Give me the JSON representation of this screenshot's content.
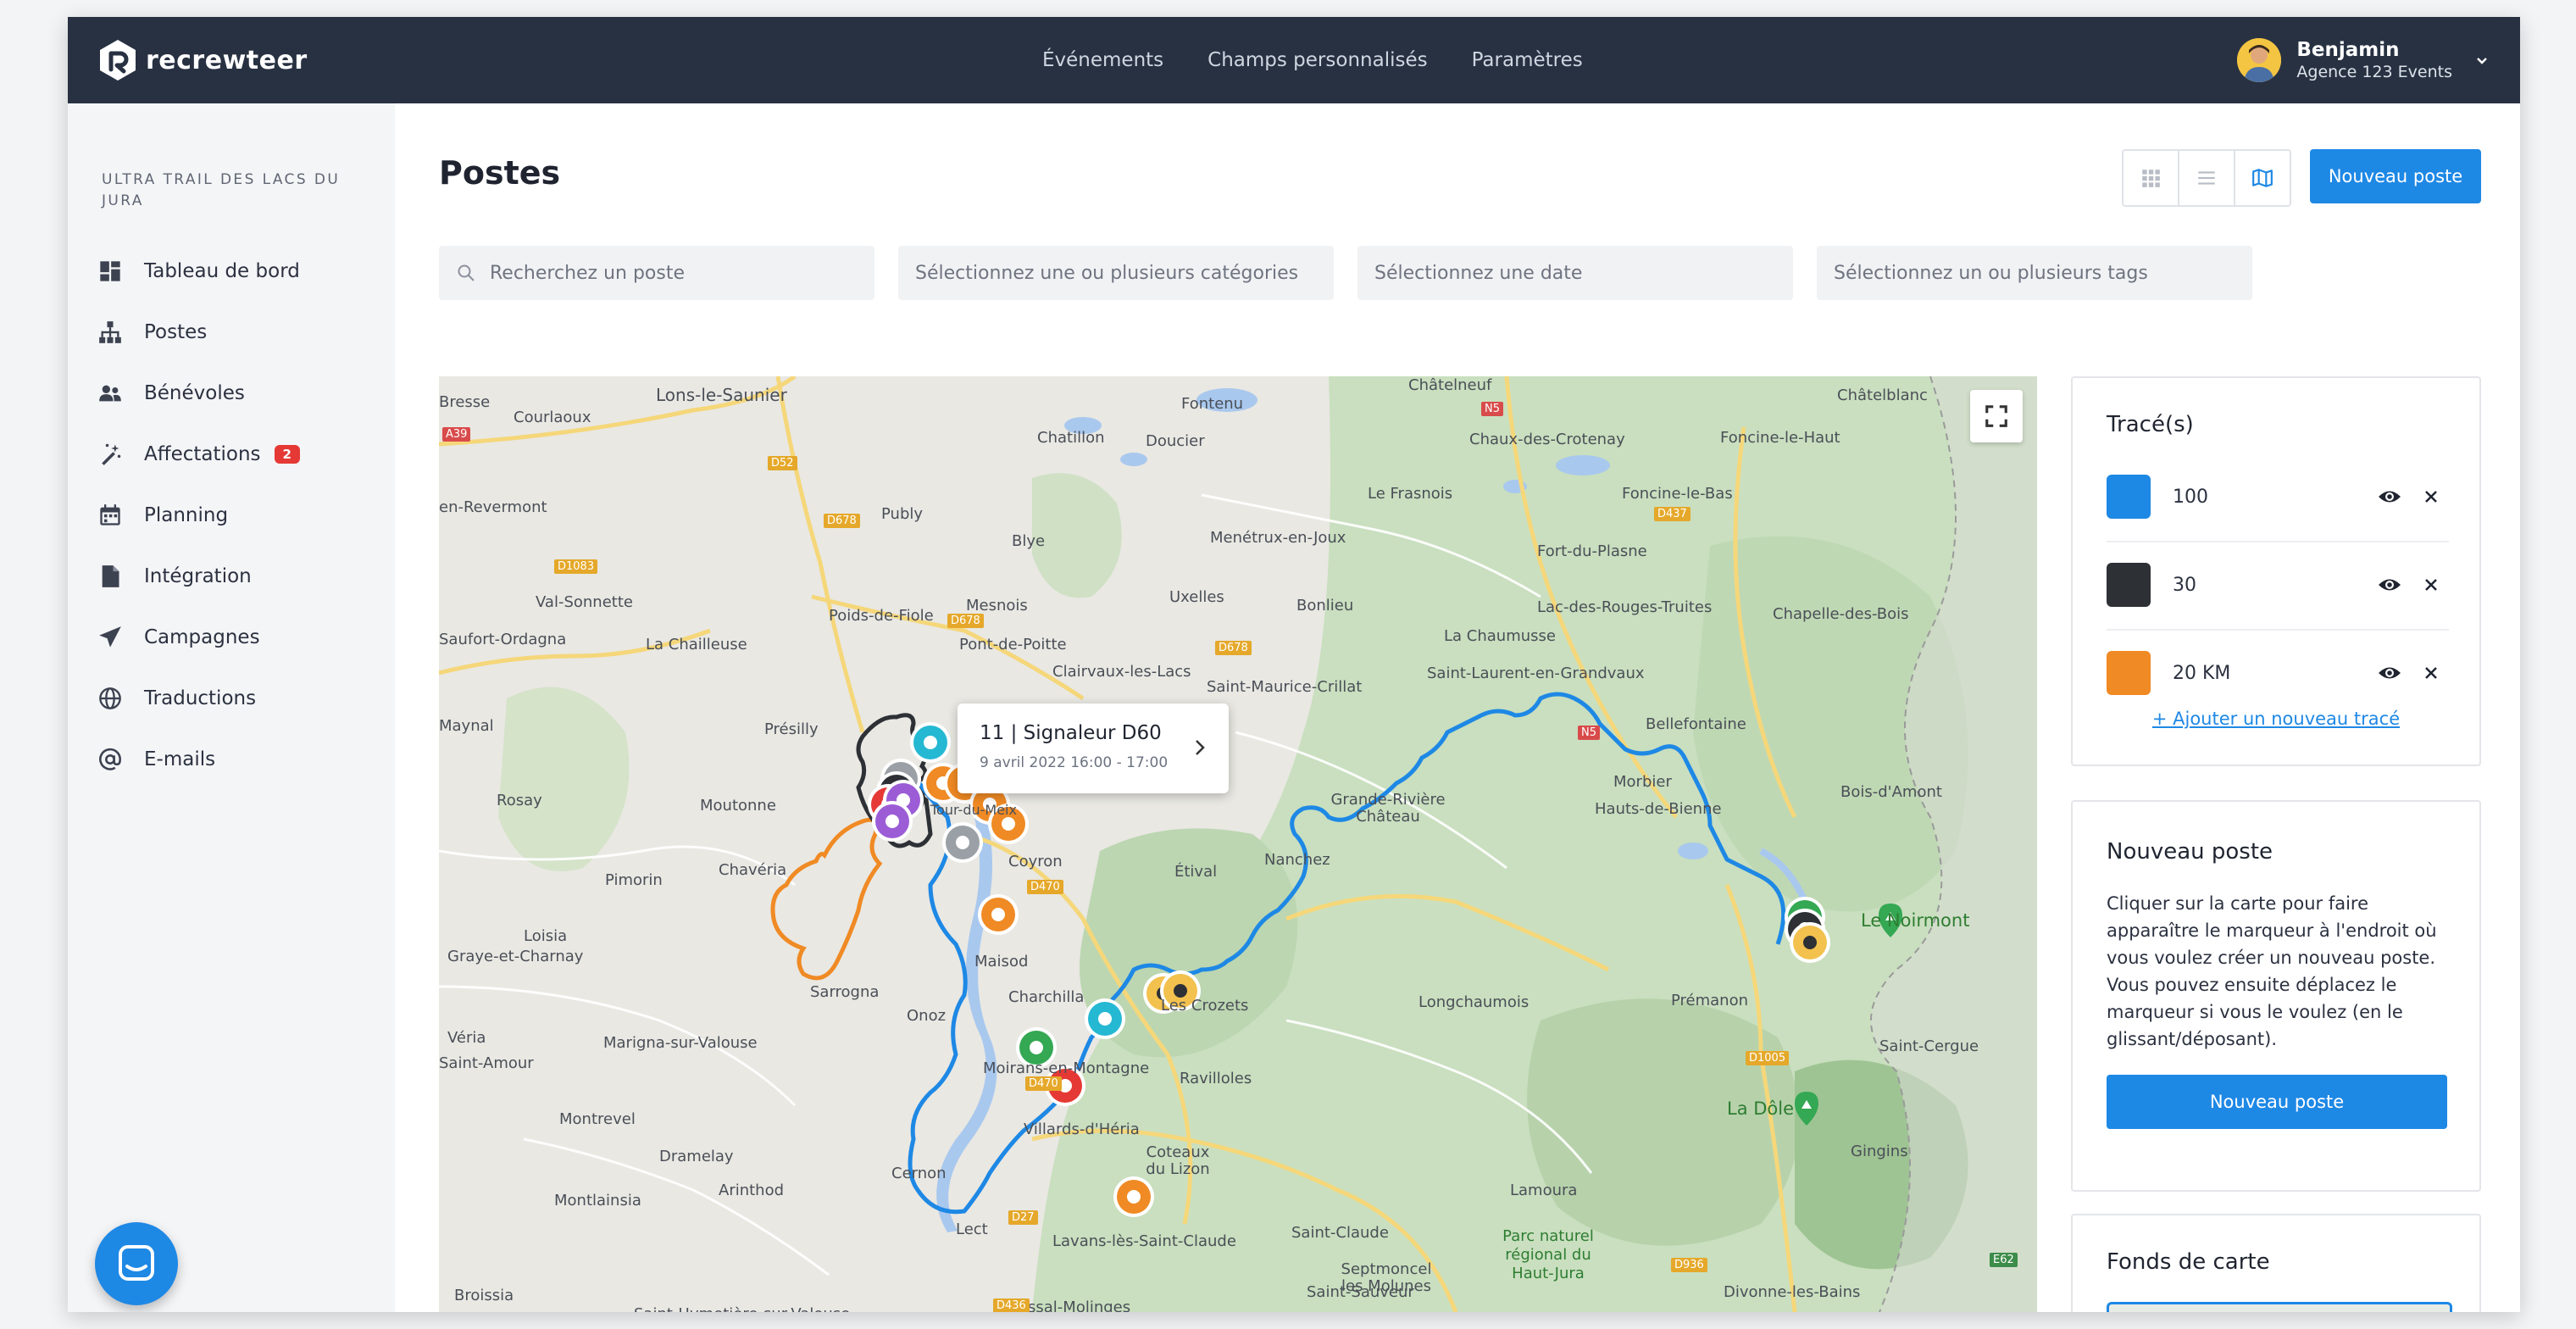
{
  "brand": {
    "name": "recrewteer"
  },
  "topnav": {
    "items": [
      "Événements",
      "Champs personnalisés",
      "Paramètres"
    ]
  },
  "user": {
    "name": "Benjamin",
    "org": "Agence 123 Events"
  },
  "sidebar": {
    "event_name": "ULTRA TRAIL DES LACS DU JURA",
    "items": [
      {
        "label": "Tableau de bord",
        "icon": "dashboard-icon"
      },
      {
        "label": "Postes",
        "icon": "org-chart-icon"
      },
      {
        "label": "Bénévoles",
        "icon": "people-icon"
      },
      {
        "label": "Affectations",
        "icon": "magic-wand-icon",
        "badge": "2"
      },
      {
        "label": "Planning",
        "icon": "calendar-icon"
      },
      {
        "label": "Intégration",
        "icon": "document-icon"
      },
      {
        "label": "Campagnes",
        "icon": "paper-plane-icon"
      },
      {
        "label": "Traductions",
        "icon": "globe-icon"
      },
      {
        "label": "E-mails",
        "icon": "at-sign-icon"
      }
    ]
  },
  "page": {
    "title": "Postes",
    "new_button": "Nouveau poste",
    "views": [
      "grid-view-icon",
      "list-view-icon",
      "map-view-icon"
    ]
  },
  "filters": {
    "search_placeholder": "Recherchez un poste",
    "categories_placeholder": "Sélectionnez une ou plusieurs catégories",
    "date_placeholder": "Sélectionnez une date",
    "tags_placeholder": "Sélectionnez un ou plusieurs tags"
  },
  "map": {
    "popup": {
      "title": "11 | Signaleur D60",
      "time": "9 avril 2022 16:00 - 17:00"
    },
    "places": [
      "Lons-le-Saunier",
      "Fontenu",
      "Courlaoux",
      "Chatillon",
      "Doucier",
      "Châtelneuf",
      "Chaux-des-Crotenay",
      "Foncine-le-Haut",
      "Châtelblanc",
      "Le Frasnois",
      "Foncine-le-Bas",
      "Publy",
      "Blye",
      "Menétrux-en-Joux",
      "Fort-du-Plasne",
      "Val-Sonnette",
      "Mesnois",
      "Uxelles",
      "Bonlieu",
      "Lac-des-Rouges-Truites",
      "Chapelle-des-Bois",
      "Poids-de-Fiole",
      "Pont-de-Poitte",
      "La Chailleuse",
      "La Chaumusse",
      "Clairvaux-les-Lacs",
      "Saint-Maurice-Crillat",
      "Saint-Laurent-en-Grandvaux",
      "Présilly",
      "Maynal",
      "Bellefontaine",
      "Morbier",
      "Rosay",
      "Moutonne",
      "Hauts-de-Bienne",
      "Bois-d'Amont",
      "Grande-Rivière Château",
      "Nanchez",
      "Étival",
      "Coyron",
      "Pimorin",
      "Chavéria",
      "Loisia",
      "Graye-et-Charnay",
      "Maisod",
      "Le Noirmont",
      "Sarrogna",
      "Charchilla",
      "Les Crozets",
      "Onoz",
      "Longchaumois",
      "Prémanon",
      "Véria",
      "Marigna-sur-Valouse",
      "Moirans-en-Montagne",
      "Ravilloles",
      "Saint-Cergue",
      "La Dôle",
      "Montrevel",
      "Villards-d'Héria",
      "Dramelay",
      "Coteaux du Lizon",
      "Arinthod",
      "Montlainsia",
      "Cernon",
      "Lect",
      "Lamoura",
      "Gingins",
      "Lavans-lès-Saint-Claude",
      "Saint-Claude",
      "Parc naturel régional du Haut-Jura",
      "Septmoncel les Molunes",
      "Chassal-Molinges",
      "Saint-Sauveur",
      "Divonne-les-Bains",
      "Broissia",
      "Saint-Hymetière-sur-Valouse",
      "Bresse",
      "en-Revermont",
      "Saufort-Ordagna",
      "Saint-Amour",
      "Tour-du-Meix"
    ],
    "roads": [
      "A39",
      "D52",
      "D678",
      "D1083",
      "D678",
      "D678",
      "N5",
      "D437",
      "N5",
      "D470",
      "D470",
      "D27",
      "D1005",
      "D436",
      "D936",
      "E62"
    ]
  },
  "traces": {
    "title": "Tracé(s)",
    "items": [
      {
        "name": "100",
        "color": "#1e88e5"
      },
      {
        "name": "30",
        "color": "#2d3035"
      },
      {
        "name": "20 KM",
        "color": "#f08a24"
      }
    ],
    "add_label": "+ Ajouter un nouveau tracé"
  },
  "new_post_panel": {
    "title": "Nouveau poste",
    "text": "Cliquer sur la carte pour faire apparaître le marqueur à l'endroit où vous voulez créer un nouveau poste. Vous pouvez ensuite déplacez le marqueur si vous le voulez (en le glissant/déposant).",
    "button": "Nouveau poste"
  },
  "fonds_panel": {
    "title": "Fonds de carte"
  }
}
